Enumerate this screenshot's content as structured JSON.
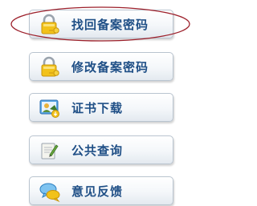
{
  "menu": {
    "items": [
      {
        "label": "找回备案密码",
        "icon": "lock-key-icon"
      },
      {
        "label": "修改备案密码",
        "icon": "lock-key-icon"
      },
      {
        "label": "证书下载",
        "icon": "certificate-download-icon"
      },
      {
        "label": "公共查询",
        "icon": "query-document-icon"
      },
      {
        "label": "意见反馈",
        "icon": "chat-bubbles-icon"
      }
    ],
    "highlighted_item": 0
  },
  "colors": {
    "label_text": "#1f4f86",
    "button_border": "#b9c4cf",
    "highlight_ellipse": "#9c1f2a"
  }
}
